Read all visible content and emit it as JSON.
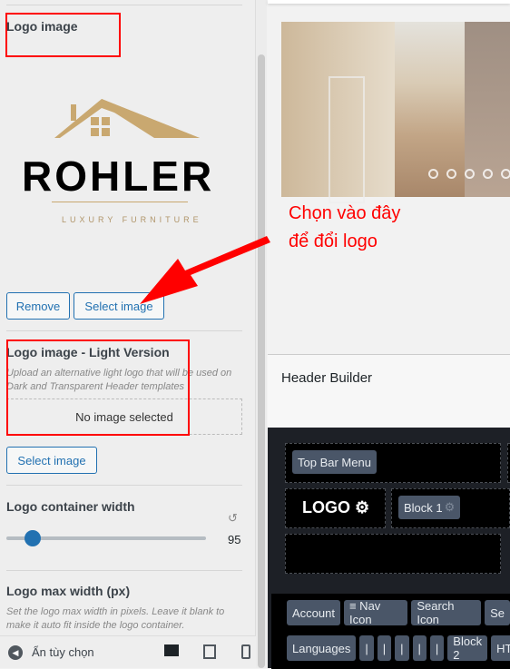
{
  "sidebar": {
    "logo_image": {
      "title": "Logo image",
      "logo_text": "ROHLER",
      "logo_tagline": "LUXURY FURNITURE",
      "remove_label": "Remove",
      "select_label": "Select image"
    },
    "logo_light": {
      "title": "Logo image - Light Version",
      "description": "Upload an alternative light logo that will be used on Dark and Transparent Header templates",
      "empty_text": "No image selected",
      "select_label": "Select image"
    },
    "container_width": {
      "title": "Logo container width",
      "value": "95",
      "slider_fraction": 0.13
    },
    "max_width": {
      "title": "Logo max width (px)",
      "description": "Set the logo max width in pixels. Leave it blank to make it auto fit inside the logo container."
    },
    "footer": {
      "hide_label": "Ẩn tùy chọn"
    }
  },
  "annotation": {
    "line1": "Chọn vào đây",
    "line2": "để đổi logo",
    "color": "#ff0000"
  },
  "preview": {
    "slider_dots": 5
  },
  "header_builder": {
    "title": "Header Builder",
    "top_bar_menu": "Top Bar Menu",
    "logo": "LOGO",
    "block1": "Block 1",
    "available": [
      "Account",
      "≡ Nav Icon",
      "Search Icon",
      "Se"
    ],
    "available2": [
      "Languages",
      "|",
      "|",
      "|",
      "|",
      "|",
      "Block 2",
      "HT"
    ]
  }
}
